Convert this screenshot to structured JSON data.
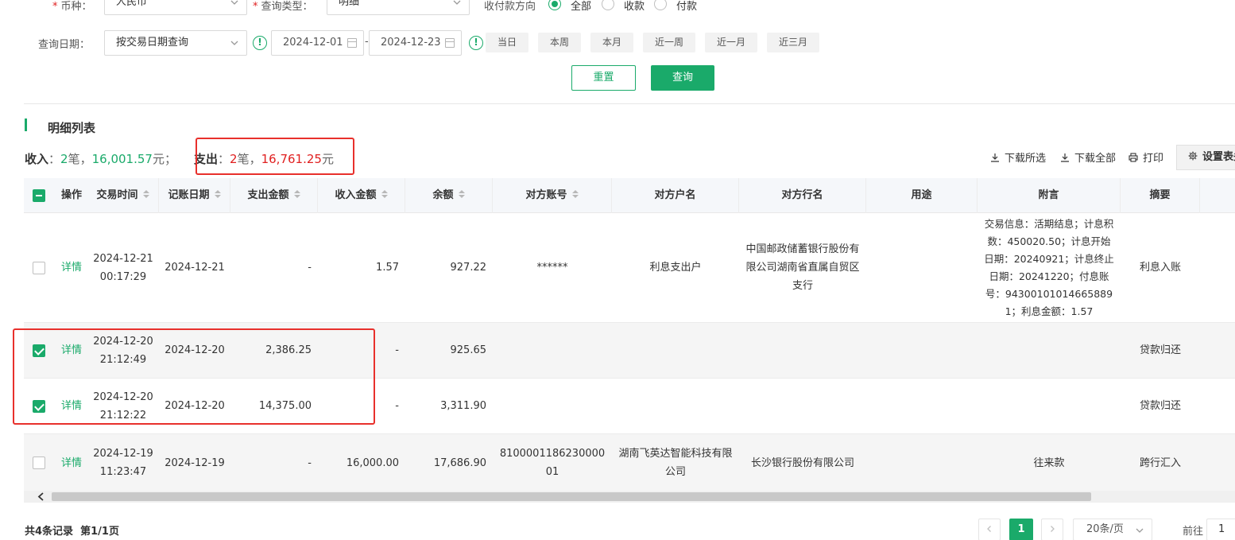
{
  "filters": {
    "currency_label": "币种",
    "currency_value": "人民币",
    "query_type_label": "查询类型",
    "query_type_value": "明细",
    "direction_label": "收付款方向",
    "direction_options": [
      "全部",
      "收款",
      "付款"
    ],
    "date_label": "查询日期",
    "date_mode_value": "按交易日期查询",
    "date_start": "2024-12-01",
    "date_sep": "-",
    "date_end": "2024-12-23",
    "quick_ranges": [
      "当日",
      "本周",
      "本月",
      "近一周",
      "近一月",
      "近三月"
    ],
    "reset_label": "重置",
    "query_label": "查询"
  },
  "section": {
    "title": "明细列表"
  },
  "summary": {
    "income_label": "收入",
    "income_count": "2",
    "income_amount": "16,001.57",
    "expense_label": "支出",
    "expense_count": "2",
    "expense_amount": "16,761.25",
    "count_unit": "笔",
    "amount_unit": "元"
  },
  "toolbar": {
    "download_selected": "下载所选",
    "download_all": "下载全部",
    "print": "打印",
    "settings": "设置表头"
  },
  "table": {
    "headers": [
      "操作",
      "交易时间",
      "记账日期",
      "支出金额",
      "收入金额",
      "余额",
      "对方账号",
      "对方户名",
      "对方行名",
      "用途",
      "附言",
      "摘要"
    ],
    "rows": [
      {
        "action": "详情",
        "time": "2024-12-21 00:17:29",
        "book_date": "2024-12-21",
        "expense": "-",
        "income": "1.57",
        "balance": "927.22",
        "account": "******",
        "account_name": "利息支出户",
        "bank_name": "中国邮政储蓄银行股份有限公司湖南省直属自贸区支行",
        "purpose": "",
        "remark": "交易信息：活期结息；计息积数：450020.50；计息开始日期：20240921；计息终止日期：20241220；付息账号：943001010146658891；利息金额：1.57",
        "summary": "利息入账",
        "checked": false
      },
      {
        "action": "详情",
        "time": "2024-12-20 21:12:49",
        "book_date": "2024-12-20",
        "expense": "2,386.25",
        "income": "-",
        "balance": "925.65",
        "account": "",
        "account_name": "",
        "bank_name": "",
        "purpose": "",
        "remark": "",
        "summary": "贷款归还",
        "checked": true
      },
      {
        "action": "详情",
        "time": "2024-12-20 21:12:22",
        "book_date": "2024-12-20",
        "expense": "14,375.00",
        "income": "-",
        "balance": "3,311.90",
        "account": "",
        "account_name": "",
        "bank_name": "",
        "purpose": "",
        "remark": "",
        "summary": "贷款归还",
        "checked": true
      },
      {
        "action": "详情",
        "time": "2024-12-19 11:23:47",
        "book_date": "2024-12-19",
        "expense": "-",
        "income": "16,000.00",
        "balance": "17,686.90",
        "account": "810000118623000001",
        "account_name": "湖南飞英达智能科技有限公司",
        "bank_name": "长沙银行股份有限公司",
        "purpose": "",
        "remark": "往来款",
        "summary": "跨行汇入",
        "checked": false
      }
    ]
  },
  "footer": {
    "total": "共4条记录",
    "page_info": "第1/1页",
    "current_page": "1",
    "page_size": "20条/页",
    "goto_label": "前往",
    "goto_value": "1"
  },
  "colors": {
    "accent": "#1aaa6a",
    "expense": "#e02020",
    "highlight": "#e8302c"
  },
  "icons": [
    "chevron-down-icon",
    "info-icon",
    "calendar-icon",
    "download-icon",
    "printer-icon",
    "gear-icon",
    "chevron-left-icon",
    "chevron-right-icon"
  ]
}
